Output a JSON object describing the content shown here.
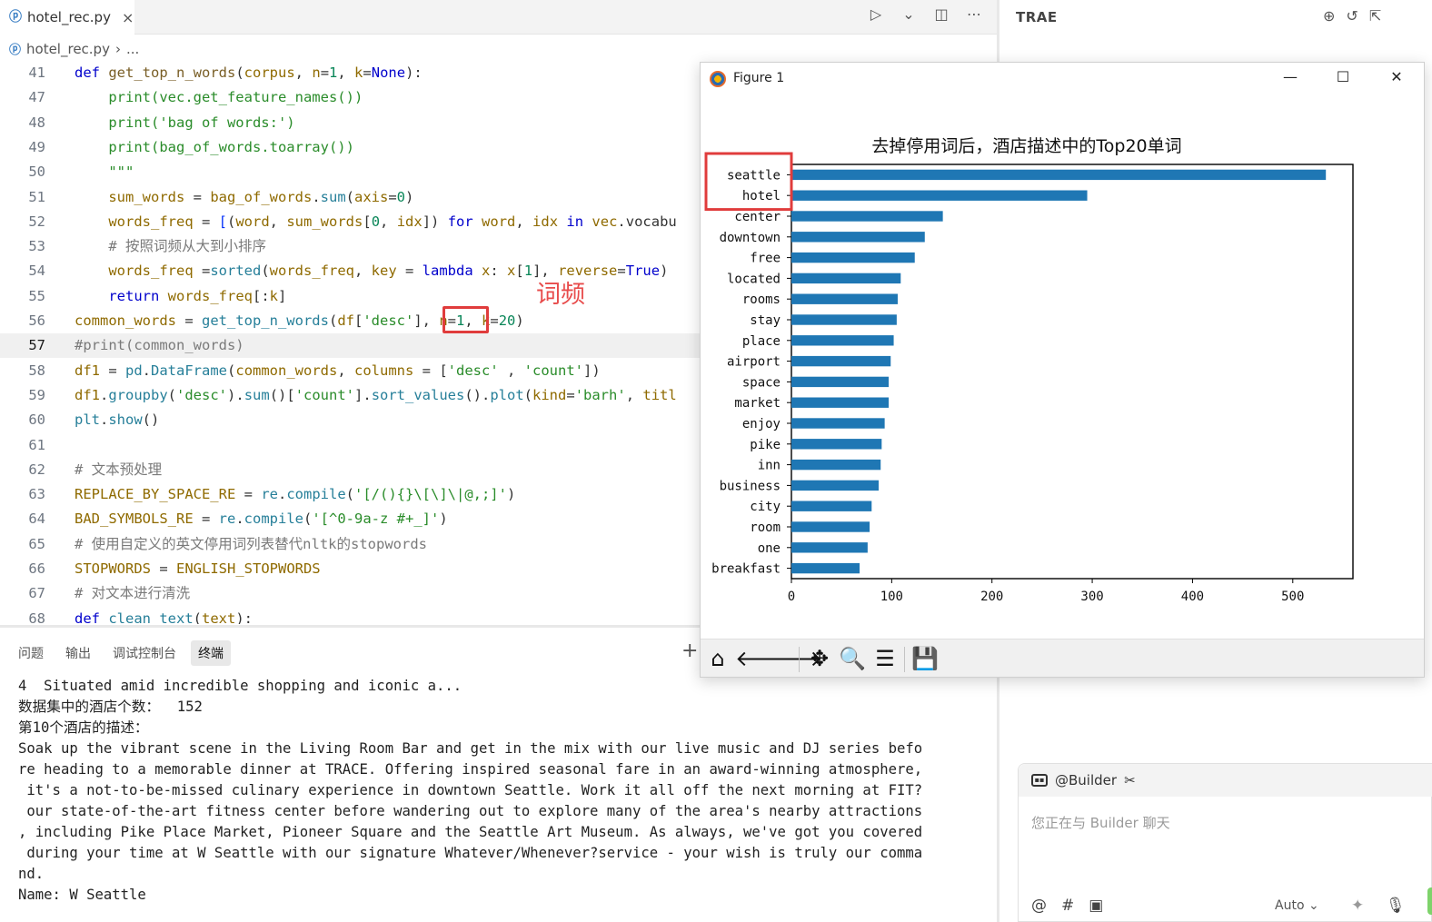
{
  "editor": {
    "tab": {
      "filename": "hotel_rec.py",
      "close": "×"
    },
    "breadcrumb": {
      "file": "hotel_rec.py",
      "separator": "›",
      "tail": "..."
    },
    "actions": {
      "run": "▷",
      "run_menu": "⌄",
      "split": "◫",
      "more": "⋯"
    },
    "current_line": "57",
    "lines": [
      {
        "n": "41",
        "html": "<span class=\"kw\">def</span> <span class=\"fn\">get_top_n_words</span>(<span class=\"var\">corpus</span>, <span class=\"var\">n</span>=<span class=\"num\">1</span>, <span class=\"var\">k</span>=<span class=\"kw\">None</span>):"
      },
      {
        "n": "47",
        "html": "    <span class=\"str2\">print(vec.get_feature_names())</span>"
      },
      {
        "n": "48",
        "html": "    <span class=\"str2\">print('bag of words:')</span>"
      },
      {
        "n": "49",
        "html": "    <span class=\"str2\">print(bag_of_words.toarray())</span>"
      },
      {
        "n": "50",
        "html": "    <span class=\"str2\">\"\"\"</span>"
      },
      {
        "n": "51",
        "html": "    <span class=\"var\">sum_words</span> = <span class=\"var\">bag_of_words</span>.<span class=\"fn2\">sum</span>(<span class=\"var\">axis</span>=<span class=\"num\">0</span>)"
      },
      {
        "n": "52",
        "html": "    <span class=\"var\">words_freq</span> = <span class=\"par\">[</span>(<span class=\"var\">word</span>, <span class=\"var\">sum_words</span>[<span class=\"num\">0</span>, <span class=\"var\">idx</span>]) <span class=\"kw\">for</span> <span class=\"var\">word</span>, <span class=\"var\">idx</span> <span class=\"kw\">in</span> <span class=\"var\">vec</span>.vocabu"
      },
      {
        "n": "53",
        "html": "    <span class=\"cmt\"># 按照词频从大到小排序</span>"
      },
      {
        "n": "54",
        "html": "    <span class=\"var\">words_freq</span> =<span class=\"fn2\">sorted</span>(<span class=\"var\">words_freq</span>, <span class=\"var\">key</span> = <span class=\"kw\">lambda</span> <span class=\"var\">x</span>: <span class=\"var\">x</span>[<span class=\"num\">1</span>], <span class=\"var\">reverse</span>=<span class=\"kw\">True</span>)"
      },
      {
        "n": "55",
        "html": "    <span class=\"kw\">return</span> <span class=\"var\">words_freq</span>[:<span class=\"var\">k</span>]"
      },
      {
        "n": "56",
        "html": "<span class=\"var\">common_words</span> = <span class=\"fn2\">get_top_n_words</span>(<span class=\"var\">df</span>[<span class=\"str2\">'desc'</span>], <span class=\"var\">n</span>=<span class=\"num\">1</span>, <span class=\"var\">k</span>=<span class=\"num\">20</span>)"
      },
      {
        "n": "57",
        "html": "<span class=\"cmt\">#print(common_words)</span>"
      },
      {
        "n": "58",
        "html": "<span class=\"var\">df1</span> = <span class=\"fn2\">pd</span>.<span class=\"fn2\">DataFrame</span>(<span class=\"var\">common_words</span>, <span class=\"var\">columns</span> = [<span class=\"str2\">'desc'</span> , <span class=\"str2\">'count'</span>])"
      },
      {
        "n": "59",
        "html": "<span class=\"var\">df1</span>.<span class=\"fn2\">groupby</span>(<span class=\"str2\">'desc'</span>).<span class=\"fn2\">sum</span>()[<span class=\"str2\">'count'</span>].<span class=\"fn2\">sort_values</span>().<span class=\"fn2\">plot</span>(<span class=\"var\">kind</span>=<span class=\"str2\">'barh'</span>, <span class=\"var\">titl</span>"
      },
      {
        "n": "60",
        "html": "<span class=\"fn2\">plt</span>.<span class=\"fn2\">show</span>()"
      },
      {
        "n": "61",
        "html": ""
      },
      {
        "n": "62",
        "html": "<span class=\"cmt\"># 文本预处理</span>"
      },
      {
        "n": "63",
        "html": "<span class=\"var\">REPLACE_BY_SPACE_RE</span> = <span class=\"fn2\">re</span>.<span class=\"fn2\">compile</span>(<span class=\"str2\">'[/(){}\\[\\]\\|@,;]'</span>)"
      },
      {
        "n": "64",
        "html": "<span class=\"var\">BAD_SYMBOLS_RE</span> = <span class=\"fn2\">re</span>.<span class=\"fn2\">compile</span>(<span class=\"str2\">'[^0-9a-z #+_]'</span>)"
      },
      {
        "n": "65",
        "html": "<span class=\"cmt\"># 使用自定义的英文停用词列表替代nltk的stopwords</span>"
      },
      {
        "n": "66",
        "html": "<span class=\"var\">STOPWORDS</span> = <span class=\"var\">ENGLISH_STOPWORDS</span>"
      },
      {
        "n": "67",
        "html": "<span class=\"cmt\"># 对文本进行清洗</span>"
      },
      {
        "n": "68",
        "html": "<span class=\"kw\">def</span> <span class=\"fn2\">clean_text</span>(<span class=\"var\">text</span>):"
      }
    ],
    "annotation": "词频"
  },
  "panel": {
    "tabs": [
      "问题",
      "输出",
      "调试控制台",
      "终端"
    ],
    "active_tab": "终端",
    "plus": "+",
    "terminal_lines": [
      "4  Situated amid incredible shopping and iconic a...",
      "数据集中的酒店个数：  152",
      "第10个酒店的描述：",
      "Soak up the vibrant scene in the Living Room Bar and get in the mix with our live music and DJ series befo",
      "re heading to a memorable dinner at TRACE. Offering inspired seasonal fare in an award-winning atmosphere,",
      " it's a not-to-be-missed culinary experience in downtown Seattle. Work it all off the next morning at FIT?",
      " our state-of-the-art fitness center before wandering out to explore many of the area's nearby attractions",
      ", including Pike Place Market, Pioneer Square and the Seattle Art Museum. As always, we've got you covered",
      " during your time at W Seattle with our signature Whatever/Whenever?service - your wish is truly our comma",
      "nd.",
      "Name: W Seattle"
    ]
  },
  "trae": {
    "title": "TRAE",
    "chat": {
      "agent": "@Builder",
      "placeholder": "您正在与 Builder 聊天",
      "mode": "Auto",
      "footer_icons": [
        "@",
        "#",
        "▣"
      ]
    }
  },
  "figure": {
    "window_title": "Figure 1",
    "controls": {
      "minimize": "—",
      "maximize": "☐",
      "close": "✕"
    }
  },
  "chart_data": {
    "type": "bar",
    "orientation": "horizontal",
    "title": "去掉停用词后，酒店描述中的Top20单词",
    "categories": [
      "seattle",
      "hotel",
      "center",
      "downtown",
      "free",
      "located",
      "rooms",
      "stay",
      "place",
      "airport",
      "space",
      "market",
      "enjoy",
      "pike",
      "inn",
      "business",
      "city",
      "room",
      "one",
      "breakfast"
    ],
    "values": [
      533,
      295,
      151,
      133,
      123,
      109,
      106,
      105,
      102,
      99,
      97,
      97,
      93,
      90,
      89,
      87,
      80,
      78,
      76,
      68
    ],
    "xlim": [
      0,
      560
    ],
    "xticks": [
      0,
      100,
      200,
      300,
      400,
      500
    ],
    "bar_color": "#1f77b4",
    "xlabel": "",
    "ylabel": "",
    "grid": false,
    "highlighted_labels": [
      "seattle",
      "hotel"
    ]
  }
}
